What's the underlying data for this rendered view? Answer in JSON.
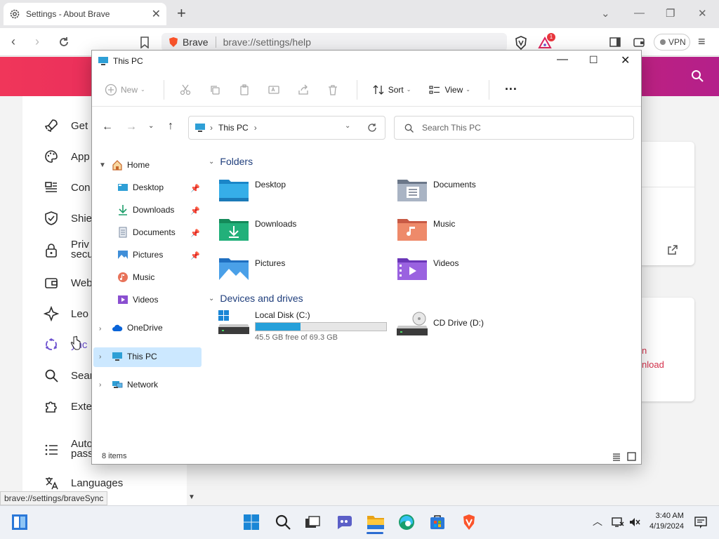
{
  "browser": {
    "tab_title": "Settings - About Brave",
    "tab_close": "✕",
    "new_tab": "+",
    "url_label": "Brave",
    "url": "brave://settings/help",
    "badge_count": "1",
    "vpn_label": "VPN",
    "accent": "#e0245e"
  },
  "settings_sidebar": {
    "items": [
      "Get",
      "App",
      "Con",
      "Shie",
      "Priv",
      "secu",
      "Web",
      "Leo",
      "ync",
      "Sear",
      "Exte",
      "Auto",
      "pass",
      "Languages"
    ]
  },
  "cards": {
    "red_line1": "n",
    "red_line2": "nload"
  },
  "status_url": "brave://settings/braveSync",
  "explorer": {
    "title": "This PC",
    "toolbar": {
      "new": "New",
      "sort": "Sort",
      "view": "View",
      "more": "···"
    },
    "address": "This PC",
    "search_placeholder": "Search This PC",
    "nav": {
      "home": "Home",
      "desktop": "Desktop",
      "downloads": "Downloads",
      "documents": "Documents",
      "pictures": "Pictures",
      "music": "Music",
      "videos": "Videos",
      "onedrive": "OneDrive",
      "this_pc": "This PC",
      "network": "Network"
    },
    "groups": {
      "folders": "Folders",
      "drives": "Devices and drives"
    },
    "folders": [
      "Desktop",
      "Documents",
      "Downloads",
      "Music",
      "Pictures",
      "Videos"
    ],
    "drives": {
      "c_name": "Local Disk (C:)",
      "c_free": "45.5 GB free of 69.3 GB",
      "c_used_fraction": 0.343,
      "d_name": "CD Drive (D:)"
    },
    "status": "8 items"
  },
  "taskbar": {
    "time": "3:40 AM",
    "date": "4/19/2024"
  }
}
